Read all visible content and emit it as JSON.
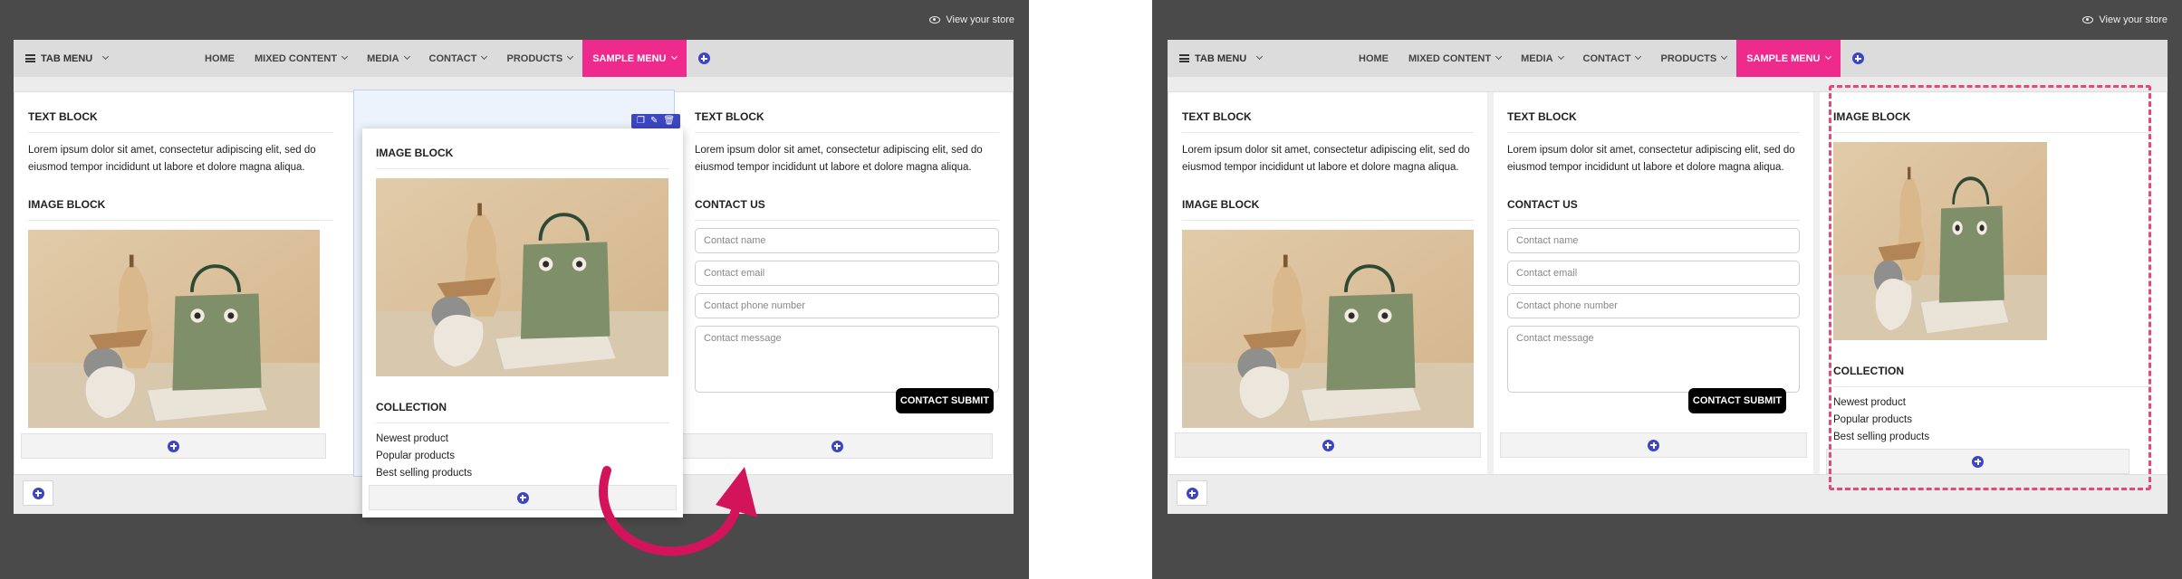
{
  "view_store": "View your store",
  "menubar": {
    "tab_menu": "TAB MENU",
    "items": [
      {
        "label": "HOME",
        "dropdown": false
      },
      {
        "label": "MIXED CONTENT",
        "dropdown": true
      },
      {
        "label": "MEDIA",
        "dropdown": true
      },
      {
        "label": "CONTACT",
        "dropdown": true
      },
      {
        "label": "PRODUCTS",
        "dropdown": true
      },
      {
        "label": "SAMPLE MENU",
        "dropdown": true,
        "active": true
      }
    ]
  },
  "blocks": {
    "text_title": "TEXT BLOCK",
    "text_body": "Lorem ipsum dolor sit amet, consectetur adipiscing elit, sed do eiusmod tempor incididunt ut labore et dolore magna aliqua.",
    "image_title": "IMAGE BLOCK",
    "collection_title": "COLLECTION",
    "collection_items": [
      "Newest product",
      "Popular products",
      "Best selling products"
    ],
    "contact_title": "CONTACT US",
    "contact_name": "Contact name",
    "contact_email": "Contact email",
    "contact_phone": "Contact phone number",
    "contact_message": "Contact message",
    "contact_submit": "CONTACT SUBMIT"
  },
  "colors": {
    "accent_pink": "#ee2b8c",
    "accent_blue": "#3c46c2",
    "highlight_dash": "#e24b78",
    "arrow": "#d4145a"
  },
  "icons": [
    "eye-icon",
    "hamburger-icon",
    "chevron-down-icon",
    "add-circle-icon",
    "duplicate-icon",
    "edit-icon",
    "trash-icon",
    "curved-arrow-icon"
  ]
}
